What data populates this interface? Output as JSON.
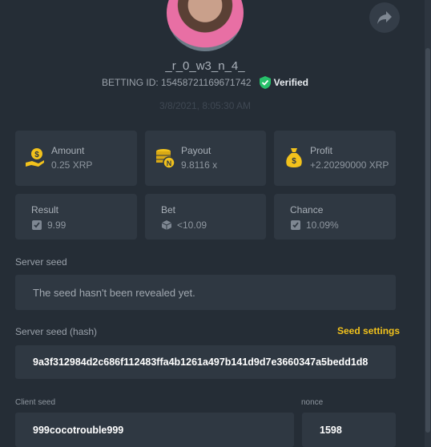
{
  "user": {
    "username": "_r_0_w3_n_4_",
    "betting_id": "BETTING ID: 15458721169671742",
    "verified_label": "Verified",
    "timestamp": "3/8/2021, 8:05:30 AM"
  },
  "stats": {
    "amount": {
      "label": "Amount",
      "value": "0.25 XRP",
      "icon": "money-bag-hand-icon"
    },
    "payout": {
      "label": "Payout",
      "value": "9.8116 x",
      "icon": "coin-stack-icon"
    },
    "profit": {
      "label": "Profit",
      "value": "+2.20290000 XRP",
      "icon": "money-bag-icon"
    },
    "result": {
      "label": "Result",
      "value": "9.99",
      "icon": "dice-check-icon"
    },
    "bet": {
      "label": "Bet",
      "value": "<10.09",
      "icon": "cube-icon"
    },
    "chance": {
      "label": "Chance",
      "value": "10.09%",
      "icon": "dice-check-icon"
    }
  },
  "server_seed": {
    "label": "Server seed",
    "value": "The seed hasn't been revealed yet."
  },
  "server_seed_hash": {
    "label": "Server seed (hash)",
    "settings_label": "Seed settings",
    "value": "9a3f312984d2c686f112483ffa4b1261a497b141d9d7e3660347a5bedd1d8"
  },
  "client_seed": {
    "label": "Client seed",
    "value": "999cocotrouble999"
  },
  "nonce": {
    "label": "nonce",
    "value": "1598"
  },
  "colors": {
    "accent": "#f2c21c",
    "verified": "#27c06a",
    "background": "#252d36",
    "card": "#2f3842"
  }
}
